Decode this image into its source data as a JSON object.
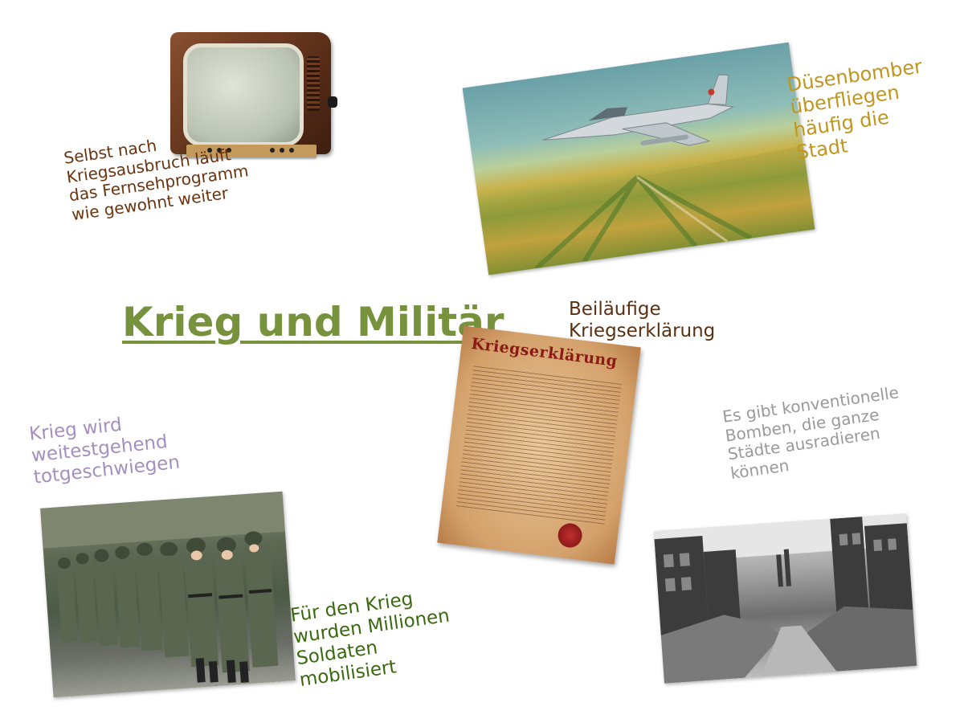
{
  "title": "Krieg und Militär",
  "notes": {
    "tv": [
      "Selbst nach",
      "Kriegsausbruch läuft",
      "das Fernsehprogramm",
      "wie gewohnt weiter"
    ],
    "jet": [
      "Düsenbomber",
      "überfliegen",
      "häufig die",
      "Stadt"
    ],
    "declaration": [
      "Beiläufige",
      "Kriegserklärung"
    ],
    "silence": [
      "Krieg wird",
      "weitestgehend",
      "totgeschwiegen"
    ],
    "bombs": [
      "Es gibt konventionelle",
      "Bomben, die ganze",
      "Städte ausradieren",
      "können"
    ],
    "soldiers": [
      "Für den Krieg",
      "wurden Millionen",
      "Soldaten",
      "mobilisiert"
    ]
  },
  "document": {
    "heading": "Kriegserklärung"
  },
  "colors": {
    "title": "#76923c",
    "tv_note": "#6b3410",
    "jet_note": "#c0961e",
    "declaration_note": "#5b3010",
    "silence_note": "#a58fc0",
    "bombs_note": "#9a9a9a",
    "soldiers_note": "#3a6a10"
  }
}
